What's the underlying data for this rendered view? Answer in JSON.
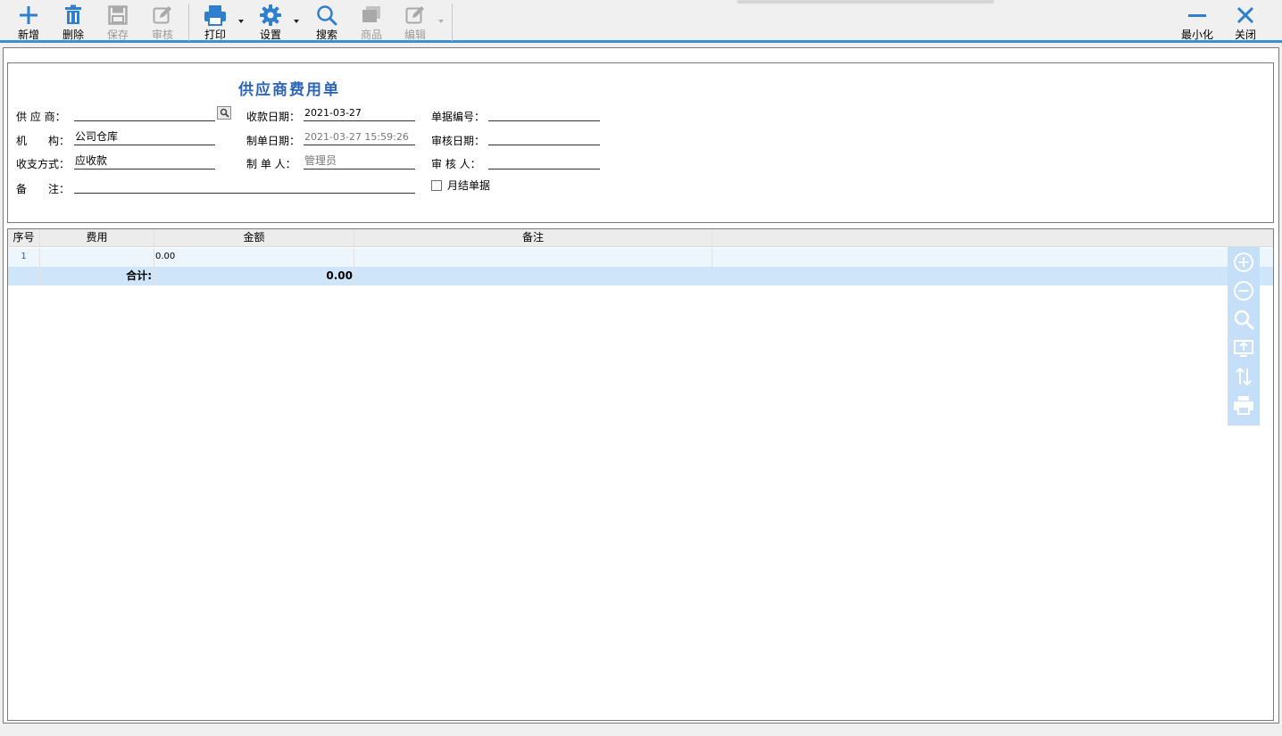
{
  "toolbar": {
    "new_label": "新增",
    "delete_label": "删除",
    "save_label": "保存",
    "audit_label": "审核",
    "print_label": "打印",
    "settings_label": "设置",
    "search_label": "搜索",
    "goods_label": "商品",
    "edit_label": "编辑",
    "minimize_label": "最小化",
    "close_label": "关闭"
  },
  "form": {
    "title": "供应商费用单",
    "supplier": {
      "label": "供 应 商：",
      "value": ""
    },
    "org": {
      "label": "机　　构：",
      "value": "公司仓库"
    },
    "pay_type": {
      "label": "收支方式：",
      "value": "应收款"
    },
    "remark": {
      "label": "备　　注：",
      "value": ""
    },
    "receive_date": {
      "label": "收款日期：",
      "value": "2021-03-27"
    },
    "create_date": {
      "label": "制单日期：",
      "value": "2021-03-27 15:59:26"
    },
    "creator": {
      "label": "制 单 人：",
      "value": "管理员"
    },
    "doc_no": {
      "label": "单据编号：",
      "value": ""
    },
    "audit_date": {
      "label": "审核日期：",
      "value": ""
    },
    "auditor": {
      "label": "审 核 人：",
      "value": ""
    },
    "monthly": {
      "label": "月结单据",
      "checked": false
    }
  },
  "grid": {
    "columns": [
      "序号",
      "费用",
      "金额",
      "备注"
    ],
    "rows": [
      {
        "seq": "1",
        "fee": "",
        "amount": "0.00",
        "note": ""
      }
    ],
    "summary": {
      "label": "合计:",
      "amount": "0.00"
    }
  },
  "colors": {
    "accent": "#3b8fd3",
    "title": "#2d66b8",
    "side_strip": "#c4dff7",
    "summary_row": "#cfe5fa"
  },
  "icons": {
    "toolbar": [
      "plus-icon",
      "trash-icon",
      "save-icon",
      "audit-icon",
      "printer-icon",
      "gear-icon",
      "search-icon",
      "goods-icon",
      "edit-icon",
      "minimize-icon",
      "close-icon"
    ],
    "side": [
      "zoom-in-icon",
      "zoom-out-icon",
      "magnify-icon",
      "screen-export-icon",
      "sort-icon",
      "print-icon"
    ]
  }
}
